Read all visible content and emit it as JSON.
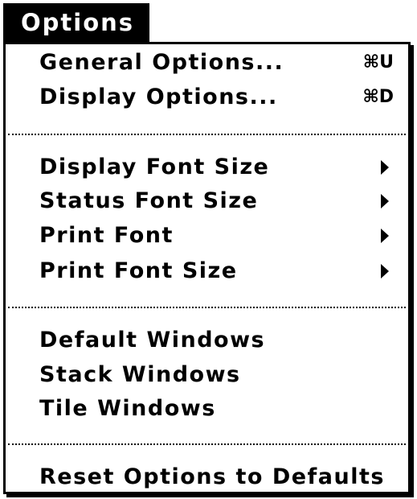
{
  "menu": {
    "title": "Options",
    "items": [
      {
        "label": "General Options...",
        "shortcut": "⌘U"
      },
      {
        "label": "Display Options...",
        "shortcut": "⌘D"
      },
      {
        "label": "Display Font Size",
        "submenu_icon": "triangle-right-icon"
      },
      {
        "label": "Status Font Size",
        "submenu_icon": "triangle-right-icon"
      },
      {
        "label": "Print Font",
        "submenu_icon": "triangle-right-icon"
      },
      {
        "label": "Print Font Size",
        "submenu_icon": "triangle-right-icon"
      },
      {
        "label": "Default Windows"
      },
      {
        "label": "Stack Windows"
      },
      {
        "label": "Tile Windows"
      },
      {
        "label": "Reset Options to Defaults"
      }
    ]
  }
}
